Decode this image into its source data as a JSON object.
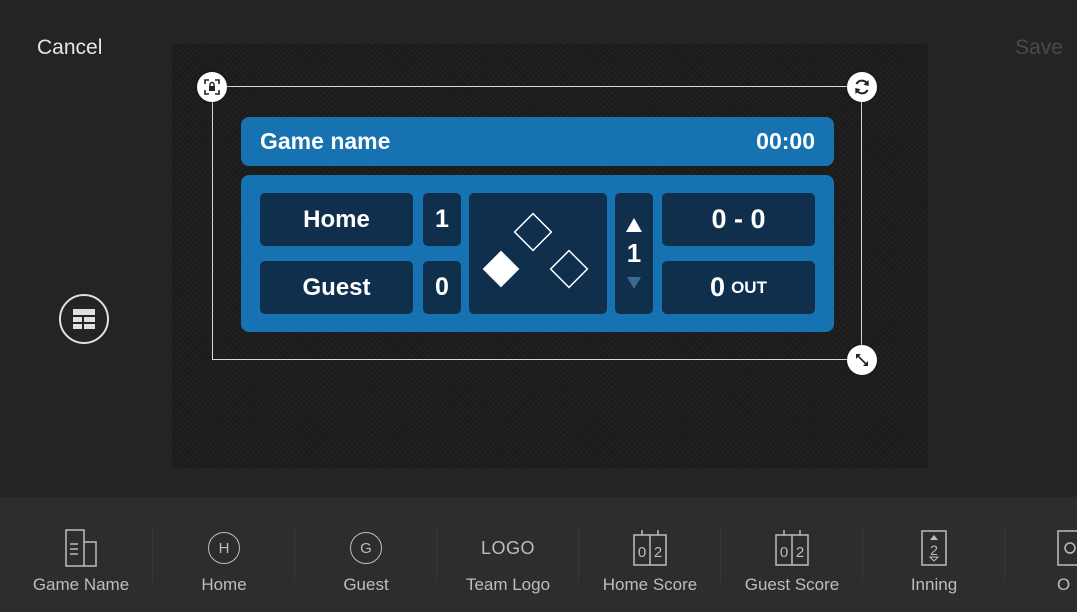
{
  "topbar": {
    "cancel_label": "Cancel",
    "save_label": "Save"
  },
  "scoreboard": {
    "game_name": "Game name",
    "clock": "00:00",
    "home_team": "Home",
    "guest_team": "Guest",
    "home_score": "1",
    "guest_score": "0",
    "inning": "1",
    "count": "0 - 0",
    "outs": "0",
    "outs_label": "OUT",
    "colors": {
      "panel": "#1672b0",
      "cell": "#0f2f4d"
    }
  },
  "toolbar": {
    "items": [
      {
        "label": "Game Name",
        "icon": "game-name-icon"
      },
      {
        "label": "Home",
        "icon": "home-icon",
        "glyph": "H"
      },
      {
        "label": "Guest",
        "icon": "guest-icon",
        "glyph": "G"
      },
      {
        "label": "Team Logo",
        "icon": "logo-icon",
        "glyph": "LOGO"
      },
      {
        "label": "Home Score",
        "icon": "home-score-icon",
        "glyph": "0|2"
      },
      {
        "label": "Guest Score",
        "icon": "guest-score-icon",
        "glyph": "0|2"
      },
      {
        "label": "Inning",
        "icon": "inning-icon",
        "glyph": "2"
      },
      {
        "label": "O",
        "icon": "outs-icon",
        "glyph": "O"
      }
    ]
  }
}
